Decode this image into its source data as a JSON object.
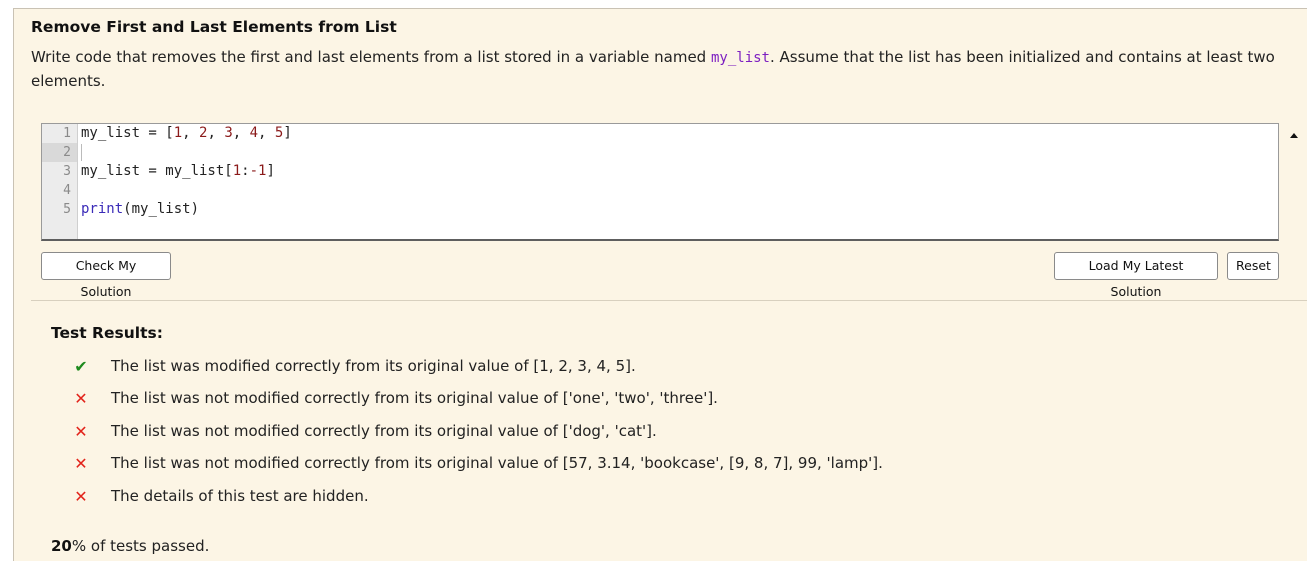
{
  "exercise": {
    "title": "Remove First and Last Elements from List",
    "description_before": "Write code that removes the first and last elements from a list stored in a variable named ",
    "description_code": "my_list",
    "description_after": ". Assume that the list has been initialized and contains at least two elements."
  },
  "editor": {
    "line_numbers": [
      "1",
      "2",
      "3",
      "4",
      "5"
    ],
    "active_line": 2,
    "lines": [
      "my_list = [1, 2, 3, 4, 5]",
      "",
      "my_list = my_list[1:-1]",
      "",
      "print(my_list)"
    ]
  },
  "buttons": {
    "check": "Check My Solution",
    "load_latest": "Load My Latest Solution",
    "reset": "Reset"
  },
  "results": {
    "title": "Test Results:",
    "items": [
      {
        "status": "pass",
        "icon": "check-icon",
        "text": "The list was modified correctly from its original value of [1, 2, 3, 4, 5]."
      },
      {
        "status": "fail",
        "icon": "cross-icon",
        "text": "The list was not modified correctly from its original value of ['one', 'two', 'three']."
      },
      {
        "status": "fail",
        "icon": "cross-icon",
        "text": "The list was not modified correctly from its original value of ['dog', 'cat']."
      },
      {
        "status": "fail",
        "icon": "cross-icon",
        "text": "The list was not modified correctly from its original value of [57, 3.14, 'bookcase', [9, 8, 7], 99, 'lamp']."
      },
      {
        "status": "fail",
        "icon": "cross-icon",
        "text": "The details of this test are hidden."
      }
    ],
    "summary_percent": "20",
    "summary_suffix": "% of tests passed."
  },
  "colors": {
    "panel_bg": "#fcf5e5",
    "pass": "#1e8a1e",
    "fail": "#e2231a",
    "inline_code": "#7d1fc1"
  }
}
